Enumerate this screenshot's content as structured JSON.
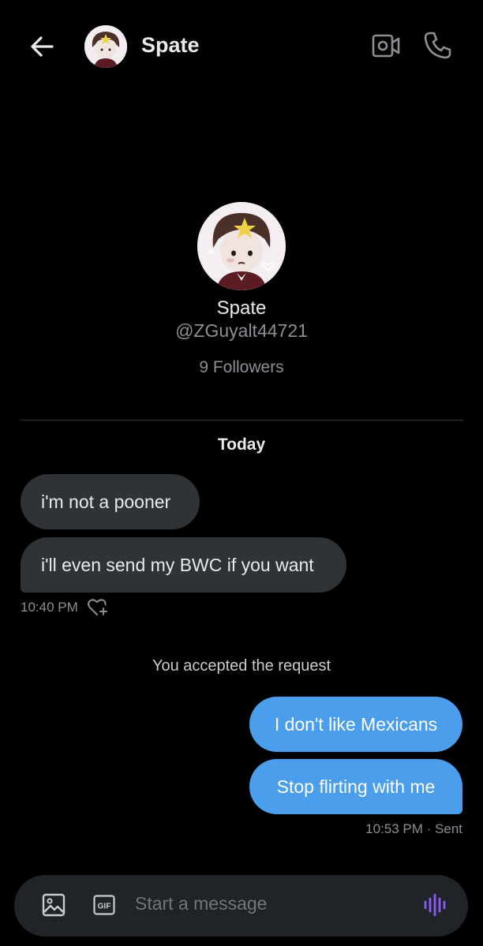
{
  "header": {
    "name": "Spate"
  },
  "profile": {
    "name": "Spate",
    "handle": "@ZGuyalt44721",
    "followers": "9 Followers"
  },
  "messages": {
    "day_label": "Today",
    "incoming": [
      "i'm not a pooner",
      "i'll even send my BWC if you want"
    ],
    "incoming_time": "10:40 PM",
    "system_note": "You accepted the request",
    "outgoing": [
      "I don't like Mexicans",
      "Stop flirting with me"
    ],
    "outgoing_meta": "10:53 PM · Sent"
  },
  "composer": {
    "placeholder": "Start a message",
    "gif_label": "GIF"
  },
  "colors": {
    "background": "#000000",
    "incoming_bubble": "#2f3336",
    "outgoing_bubble": "#4a9eeb",
    "voice_accent": "#8b5cf6"
  }
}
